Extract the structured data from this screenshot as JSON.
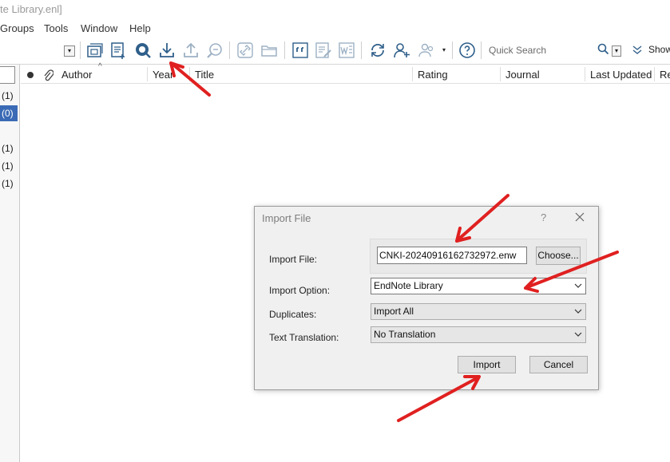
{
  "window": {
    "title_fragment": "te Library.enl]"
  },
  "menu": {
    "items": [
      "Groups",
      "Tools",
      "Window",
      "Help"
    ]
  },
  "toolbar": {
    "dropdown_glyph": "▾",
    "icons": [
      "group-window-icon",
      "new-reference-icon",
      "online-search-icon",
      "import-icon",
      "export-icon",
      "find-fulltext-icon",
      "link-icon",
      "open-folder-icon",
      "insert-citation-icon",
      "edit-citation-icon",
      "word-icon",
      "sync-icon",
      "share-icon",
      "user-group-icon",
      "help-icon"
    ],
    "quick_search_placeholder": "Quick Search",
    "show_label": "Show"
  },
  "left_pane": {
    "counts": [
      "(1)",
      "(0)",
      "(1)",
      "(1)",
      "(1)"
    ],
    "selected_index": 1,
    "selected_color": "#3a6ab5"
  },
  "columns": {
    "headers": [
      "Author",
      "Year",
      "Title",
      "Rating",
      "Journal",
      "Last Updated",
      "Re"
    ]
  },
  "dialog": {
    "title": "Import File",
    "help_glyph": "?",
    "import_file_label": "Import File:",
    "import_file_value": "CNKI-20240916162732972.enw",
    "choose_label": "Choose...",
    "import_option_label": "Import Option:",
    "import_option_value": "EndNote Library",
    "duplicates_label": "Duplicates:",
    "duplicates_value": "Import All",
    "translation_label": "Text Translation:",
    "translation_value": "No Translation",
    "import_button": "Import",
    "cancel_button": "Cancel"
  },
  "colors": {
    "annotation_arrow": "#e02020",
    "icon_blue": "#2f5f8a"
  }
}
